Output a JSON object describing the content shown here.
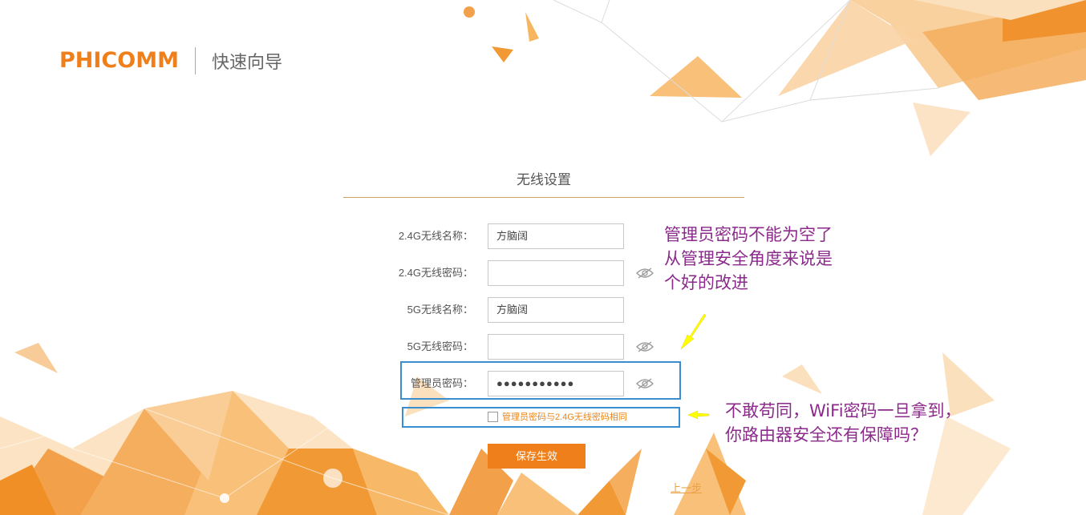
{
  "header": {
    "brand": "PHICOMM",
    "subtitle": "快速向导"
  },
  "section": {
    "title": "无线设置"
  },
  "form": {
    "fields": [
      {
        "label": "2.4G无线名称：",
        "value": "方脑阔",
        "type": "text"
      },
      {
        "label": "2.4G无线密码：",
        "value": "",
        "type": "password"
      },
      {
        "label": "5G无线名称：",
        "value": "方脑阔",
        "type": "text"
      },
      {
        "label": "5G无线密码：",
        "value": "",
        "type": "password"
      },
      {
        "label": "管理员密码：",
        "value": "●●●●●●●●●●●",
        "type": "password"
      }
    ],
    "same_password_checkbox": {
      "label": "管理员密码与2.4G无线密码相同",
      "checked": false
    },
    "save_button": "保存生效",
    "prev_link": "上一步"
  },
  "annotations": {
    "note1": [
      "管理员密码不能为空了",
      "从管理安全角度来说是",
      "个好的改进"
    ],
    "note2": [
      "不敢苟同，WiFi密码一旦拿到，",
      "你路由器安全还有保障吗？"
    ]
  },
  "colors": {
    "brand": "#ef7f1a",
    "annotation_text": "#8b2a8b",
    "highlight_box": "#3a8ed0",
    "arrow": "#ffff00"
  }
}
